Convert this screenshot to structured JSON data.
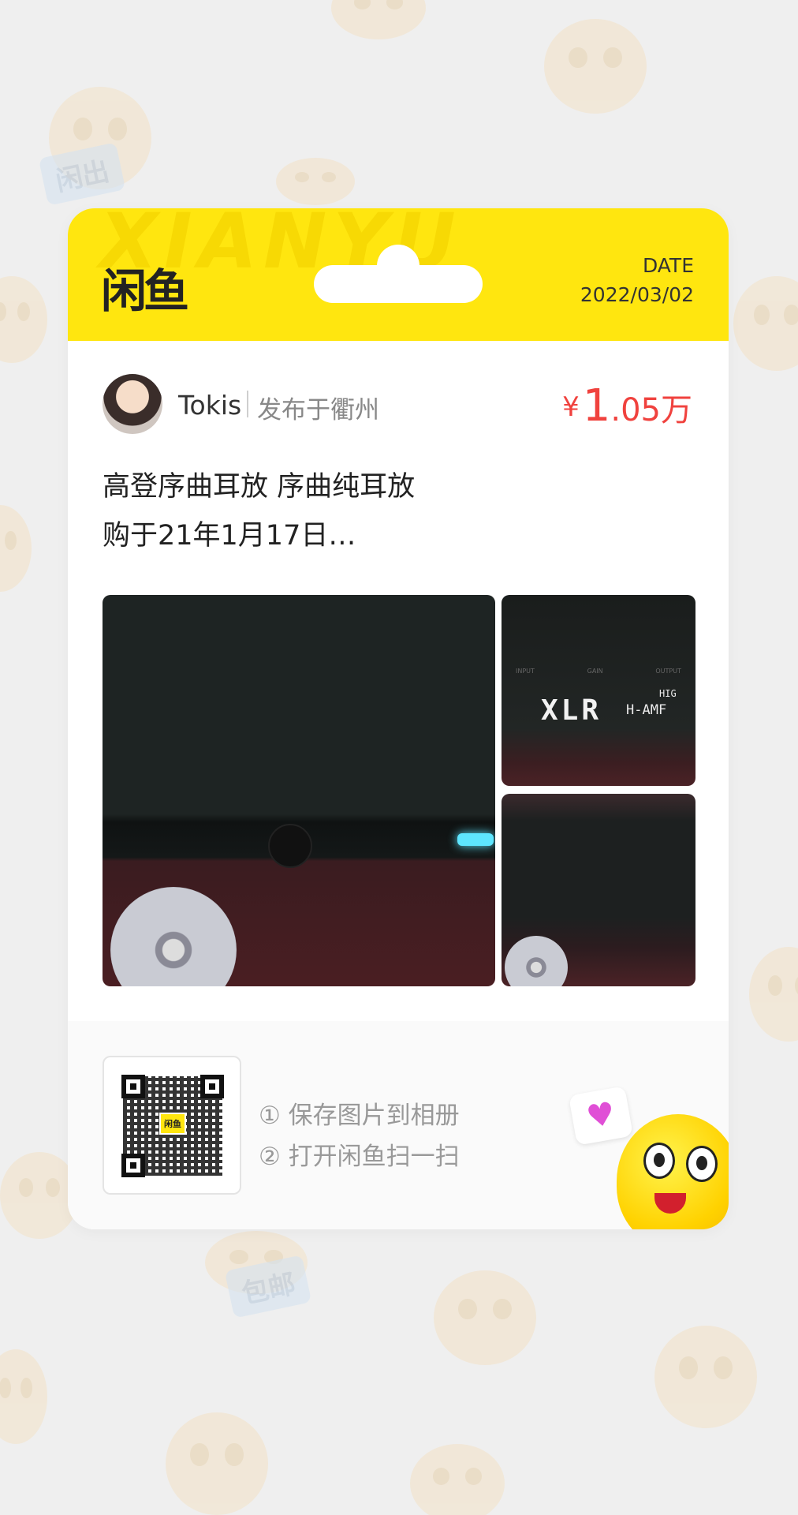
{
  "header": {
    "watermark": "XIANYU",
    "logo": "闲鱼",
    "date_label": "DATE",
    "date_value": "2022/03/02"
  },
  "seller": {
    "name": "Tokis",
    "location": "发布于衢州"
  },
  "price": {
    "currency": "¥",
    "integer": "1",
    "decimal": ".05万"
  },
  "description": {
    "line1": "高登序曲耳放 序曲纯耳放",
    "line2": "购于21年1月17日…"
  },
  "photos": {
    "top_text_xlr": "XLR",
    "top_text_hamp": "H-AMF",
    "top_text_hig": "HIG",
    "top_labels": [
      "INPUT",
      "GAIN",
      "OUTPUT"
    ]
  },
  "footer": {
    "qr_center_label": "闲鱼",
    "step1": "① 保存图片到相册",
    "step2": "② 打开闲鱼扫一扫"
  },
  "background_tags": [
    "闲出",
    "包邮"
  ],
  "colors": {
    "brand_yellow": "#ffe60f",
    "price_red": "#f0423e"
  }
}
